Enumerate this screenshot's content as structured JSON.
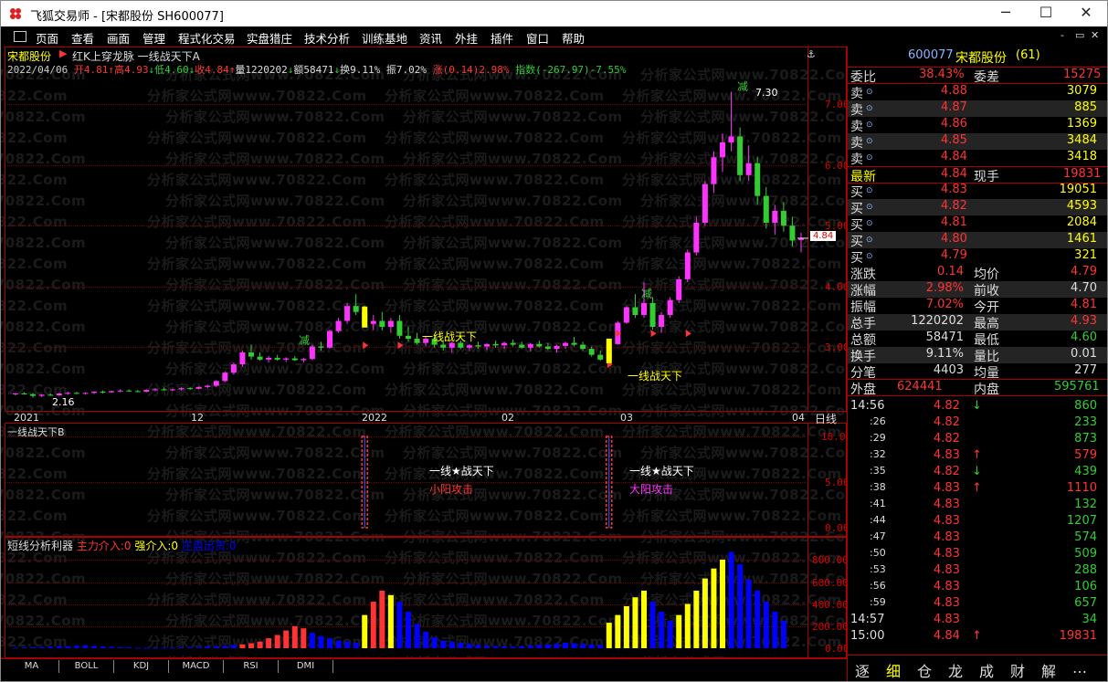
{
  "window": {
    "title": "飞狐交易师 - [宋都股份 SH600077]",
    "buttons": {
      "minimize": "─",
      "maximize": "☐",
      "close": "✕"
    }
  },
  "menu": [
    "页面",
    "查看",
    "画面",
    "管理",
    "程式化交易",
    "实盘猎庄",
    "技术分析",
    "训练基地",
    "资讯",
    "外挂",
    "插件",
    "窗口",
    "帮助"
  ],
  "menu_controls": {
    "min": "-",
    "restore": "▭",
    "close": "✕"
  },
  "colors": {
    "up": "#ff33ff",
    "down": "#33cc33",
    "red": "#ff3333",
    "yellow": "#ffff00",
    "blue": "#0000ff",
    "bg": "#000000",
    "frame": "#aa0000"
  },
  "watermark": {
    "line_a": "分析家公式网www.70822.Com",
    "line_b": "网www.70822.Com"
  },
  "main_chart": {
    "stock_name": "宋都股份",
    "indicator_title": "红K上穿龙脉  一线战天下A",
    "date": "2022/04/06",
    "open": "开4.81",
    "high": "高4.93",
    "low": "低4.60",
    "close": "收4.84",
    "volume": "量1220202",
    "amount": "额58471",
    "turnover": "换9.11%",
    "amplitude": "振7.02%",
    "change": "涨(0.14)2.98%",
    "index": "指数(-267.97)-7.55%",
    "price_labels": [
      "7.00",
      "6.00",
      "5.00",
      "4.00",
      "3.00"
    ],
    "current_price_tag": "4.84",
    "annotations": {
      "high_label": "7.30",
      "low_label": "2.16",
      "jian1": "减",
      "jian2": "减",
      "jian3": "减",
      "signal1": "一线战天下",
      "signal2": "一线战天下"
    },
    "x_labels": [
      "2021",
      "12",
      "2022",
      "02",
      "03",
      "04"
    ],
    "period": "日线"
  },
  "sub1": {
    "title": "一线战天下B",
    "y_labels": [
      "10.00",
      "5.00",
      "0.00"
    ],
    "signal_text": "一线★战天下",
    "attack1": "小阳攻击",
    "attack2": "大阳攻击"
  },
  "sub2": {
    "title": "短线分析利器",
    "legend1": "主力介入:0",
    "legend2": "强介入:0",
    "legend3": "庄盘出货:0",
    "y_labels": [
      "800.00",
      "600.00",
      "400.00",
      "200.00",
      "0.00"
    ]
  },
  "bottom_tabs": [
    "MA",
    "BOLL",
    "KDJ",
    "MACD",
    "RSI",
    "DMI"
  ],
  "quote": {
    "code": "600077",
    "name": "宋都股份",
    "count": "(61)",
    "weibi_label": "委比",
    "weibi": "38.43%",
    "weicha_label": "委差",
    "weicha": "15275",
    "sells": [
      {
        "label": "卖",
        "price": "4.88",
        "vol": "3079"
      },
      {
        "label": "卖",
        "price": "4.87",
        "vol": "885"
      },
      {
        "label": "卖",
        "price": "4.86",
        "vol": "1369"
      },
      {
        "label": "卖",
        "price": "4.85",
        "vol": "3484"
      },
      {
        "label": "卖",
        "price": "4.84",
        "vol": "3418"
      }
    ],
    "latest_label": "最新",
    "latest": "4.84",
    "xianshou_label": "现手",
    "xianshou": "19831",
    "buys": [
      {
        "label": "买",
        "price": "4.83",
        "vol": "19051"
      },
      {
        "label": "买",
        "price": "4.82",
        "vol": "4593"
      },
      {
        "label": "买",
        "price": "4.81",
        "vol": "2084"
      },
      {
        "label": "买",
        "price": "4.80",
        "vol": "1461"
      },
      {
        "label": "买",
        "price": "4.79",
        "vol": "321"
      }
    ],
    "stats": [
      {
        "l1": "涨跌",
        "v1": "0.14",
        "l2": "均价",
        "v2": "4.79"
      },
      {
        "l1": "涨幅",
        "v1": "2.98%",
        "l2": "前收",
        "v2": "4.70"
      },
      {
        "l1": "振幅",
        "v1": "7.02%",
        "l2": "今开",
        "v2": "4.81"
      },
      {
        "l1": "总手",
        "v1": "1220202",
        "l2": "最高",
        "v2": "4.93"
      },
      {
        "l1": "总额",
        "v1": "58471",
        "l2": "最低",
        "v2": "4.60"
      },
      {
        "l1": "换手",
        "v1": "9.11%",
        "l2": "量比",
        "v2": "0.01"
      },
      {
        "l1": "分笔",
        "v1": "4403",
        "l2": "均量",
        "v2": "277"
      }
    ],
    "waipan_label": "外盘",
    "waipan": "624441",
    "neipan_label": "内盘",
    "neipan": "595761"
  },
  "ticks": [
    {
      "time": "14:56",
      "price": "4.82",
      "vol": "860",
      "arrow": "↓"
    },
    {
      "time": ":26",
      "price": "4.82",
      "vol": "233",
      "arrow": ""
    },
    {
      "time": ":29",
      "price": "4.82",
      "vol": "873",
      "arrow": ""
    },
    {
      "time": ":32",
      "price": "4.83",
      "vol": "579",
      "arrow": "↑"
    },
    {
      "time": ":35",
      "price": "4.82",
      "vol": "439",
      "arrow": "↓"
    },
    {
      "time": ":38",
      "price": "4.83",
      "vol": "1110",
      "arrow": "↑"
    },
    {
      "time": ":41",
      "price": "4.83",
      "vol": "132",
      "arrow": ""
    },
    {
      "time": ":44",
      "price": "4.83",
      "vol": "1207",
      "arrow": ""
    },
    {
      "time": ":47",
      "price": "4.83",
      "vol": "574",
      "arrow": ""
    },
    {
      "time": ":50",
      "price": "4.83",
      "vol": "509",
      "arrow": ""
    },
    {
      "time": ":53",
      "price": "4.83",
      "vol": "288",
      "arrow": ""
    },
    {
      "time": ":56",
      "price": "4.83",
      "vol": "106",
      "arrow": ""
    },
    {
      "time": ":59",
      "price": "4.83",
      "vol": "657",
      "arrow": ""
    },
    {
      "time": "14:57",
      "price": "4.83",
      "vol": "34",
      "arrow": ""
    },
    {
      "time": "15:00",
      "price": "4.84",
      "vol": "19831",
      "arrow": "↑"
    }
  ],
  "right_tabs": [
    "逐",
    "细",
    "仓",
    "龙",
    "成",
    "财",
    "解",
    "…"
  ],
  "chart_data": {
    "type": "candlestick",
    "title": "宋都股份",
    "x_ticks": [
      "2021",
      "12",
      "2022",
      "02",
      "03",
      "04"
    ],
    "ylim": [
      2.0,
      7.6
    ],
    "candles": [
      [
        2.22,
        2.24,
        2.2,
        2.23
      ],
      [
        2.23,
        2.25,
        2.21,
        2.22
      ],
      [
        2.22,
        2.24,
        2.16,
        2.19
      ],
      [
        2.19,
        2.22,
        2.17,
        2.21
      ],
      [
        2.21,
        2.23,
        2.19,
        2.2
      ],
      [
        2.2,
        2.24,
        2.19,
        2.23
      ],
      [
        2.23,
        2.26,
        2.21,
        2.24
      ],
      [
        2.24,
        2.26,
        2.22,
        2.23
      ],
      [
        2.23,
        2.25,
        2.21,
        2.24
      ],
      [
        2.24,
        2.27,
        2.22,
        2.26
      ],
      [
        2.26,
        2.28,
        2.23,
        2.25
      ],
      [
        2.25,
        2.28,
        2.24,
        2.27
      ],
      [
        2.27,
        2.3,
        2.25,
        2.28
      ],
      [
        2.28,
        2.3,
        2.26,
        2.27
      ],
      [
        2.27,
        2.29,
        2.25,
        2.26
      ],
      [
        2.26,
        2.3,
        2.25,
        2.29
      ],
      [
        2.29,
        2.32,
        2.27,
        2.3
      ],
      [
        2.3,
        2.33,
        2.28,
        2.29
      ],
      [
        2.29,
        2.31,
        2.27,
        2.3
      ],
      [
        2.3,
        2.33,
        2.28,
        2.32
      ],
      [
        2.32,
        2.34,
        2.29,
        2.31
      ],
      [
        2.31,
        2.35,
        2.3,
        2.34
      ],
      [
        2.34,
        2.38,
        2.32,
        2.36
      ],
      [
        2.36,
        2.45,
        2.34,
        2.44
      ],
      [
        2.44,
        2.6,
        2.42,
        2.58
      ],
      [
        2.58,
        2.75,
        2.55,
        2.72
      ],
      [
        2.72,
        2.95,
        2.68,
        2.92
      ],
      [
        2.92,
        3.05,
        2.8,
        2.85
      ],
      [
        2.85,
        2.92,
        2.78,
        2.8
      ],
      [
        2.8,
        2.86,
        2.75,
        2.83
      ],
      [
        2.83,
        2.88,
        2.78,
        2.8
      ],
      [
        2.8,
        2.84,
        2.76,
        2.82
      ],
      [
        2.82,
        2.86,
        2.78,
        2.79
      ],
      [
        2.79,
        2.83,
        2.75,
        2.81
      ],
      [
        2.81,
        3.05,
        2.79,
        3.02
      ],
      [
        3.02,
        3.1,
        2.95,
        3.0
      ],
      [
        3.0,
        3.3,
        2.98,
        3.28
      ],
      [
        3.28,
        3.5,
        3.25,
        3.45
      ],
      [
        3.45,
        3.75,
        3.4,
        3.7
      ],
      [
        3.7,
        3.9,
        3.55,
        3.6
      ],
      [
        3.6,
        3.7,
        3.35,
        3.4
      ],
      [
        3.4,
        3.55,
        3.3,
        3.45
      ],
      [
        3.45,
        3.6,
        3.3,
        3.35
      ],
      [
        3.35,
        3.5,
        3.25,
        3.45
      ],
      [
        3.45,
        3.55,
        3.15,
        3.2
      ],
      [
        3.2,
        3.35,
        3.1,
        3.15
      ],
      [
        3.15,
        3.25,
        3.05,
        3.08
      ],
      [
        3.08,
        3.2,
        3.02,
        3.15
      ],
      [
        3.15,
        3.2,
        3.0,
        3.05
      ],
      [
        3.05,
        3.12,
        2.95,
        3.0
      ],
      [
        3.0,
        3.1,
        2.92,
        3.08
      ],
      [
        3.08,
        3.12,
        2.98,
        3.0
      ],
      [
        3.0,
        3.06,
        2.94,
        3.04
      ],
      [
        3.04,
        3.1,
        2.98,
        3.02
      ],
      [
        3.02,
        3.08,
        2.96,
        3.06
      ],
      [
        3.06,
        3.12,
        3.0,
        3.04
      ],
      [
        3.04,
        3.1,
        2.98,
        3.08
      ],
      [
        3.08,
        3.14,
        3.02,
        3.05
      ],
      [
        3.05,
        3.1,
        2.98,
        3.0
      ],
      [
        3.0,
        3.08,
        2.94,
        3.06
      ],
      [
        3.06,
        3.12,
        3.0,
        3.02
      ],
      [
        3.02,
        3.08,
        2.96,
        2.98
      ],
      [
        2.98,
        3.05,
        2.92,
        3.03
      ],
      [
        3.03,
        3.1,
        2.98,
        3.08
      ],
      [
        3.08,
        3.18,
        3.02,
        3.05
      ],
      [
        3.05,
        3.1,
        2.95,
        2.98
      ],
      [
        2.98,
        3.02,
        2.85,
        2.88
      ],
      [
        2.88,
        2.95,
        2.78,
        2.8
      ],
      [
        2.8,
        3.1,
        2.78,
        3.06
      ],
      [
        3.06,
        3.45,
        3.05,
        3.42
      ],
      [
        3.42,
        3.7,
        3.4,
        3.68
      ],
      [
        3.68,
        3.9,
        3.5,
        3.55
      ],
      [
        3.55,
        4.1,
        3.5,
        3.75
      ],
      [
        3.75,
        3.85,
        3.3,
        3.35
      ],
      [
        3.35,
        3.6,
        3.25,
        3.55
      ],
      [
        3.55,
        3.85,
        3.5,
        3.8
      ],
      [
        3.8,
        4.2,
        3.75,
        4.15
      ],
      [
        4.15,
        4.65,
        4.1,
        4.6
      ],
      [
        4.6,
        5.2,
        4.55,
        5.1
      ],
      [
        5.1,
        5.8,
        5.05,
        5.75
      ],
      [
        5.75,
        6.3,
        5.6,
        6.2
      ],
      [
        6.2,
        6.6,
        5.95,
        6.45
      ],
      [
        6.45,
        7.3,
        6.3,
        6.55
      ],
      [
        6.55,
        6.7,
        5.8,
        5.9
      ],
      [
        5.9,
        6.4,
        5.8,
        6.1
      ],
      [
        6.1,
        6.2,
        5.4,
        5.55
      ],
      [
        5.55,
        5.7,
        5.0,
        5.1
      ],
      [
        5.1,
        5.4,
        4.9,
        5.3
      ],
      [
        5.3,
        5.45,
        4.95,
        5.05
      ],
      [
        5.05,
        5.2,
        4.7,
        4.8
      ],
      [
        4.81,
        4.93,
        4.6,
        4.84
      ]
    ],
    "volume_series": {
      "name": "短线分析利器",
      "values": [
        5,
        8,
        10,
        12,
        15,
        20,
        18,
        22,
        25,
        20,
        15,
        12,
        10,
        8,
        5,
        4,
        3,
        5,
        6,
        8,
        10,
        12,
        15,
        18,
        22,
        30,
        35,
        45,
        60,
        90,
        120,
        160,
        200,
        180,
        140,
        110,
        90,
        70,
        60,
        50,
        300,
        420,
        520,
        480,
        420,
        330,
        220,
        150,
        100,
        70,
        60,
        50,
        40,
        30,
        25,
        20,
        18,
        15,
        20,
        25,
        30,
        35,
        40,
        50,
        45,
        40,
        35,
        30,
        230,
        300,
        380,
        460,
        520,
        420,
        330,
        250,
        300,
        400,
        520,
        630,
        720,
        800,
        870,
        760,
        620,
        520,
        420,
        330,
        250
      ]
    },
    "sub1_series": {
      "name": "一线战天下B",
      "signals": [
        {
          "index": 40,
          "value": 10
        },
        {
          "index": 68,
          "value": 10
        }
      ]
    }
  }
}
